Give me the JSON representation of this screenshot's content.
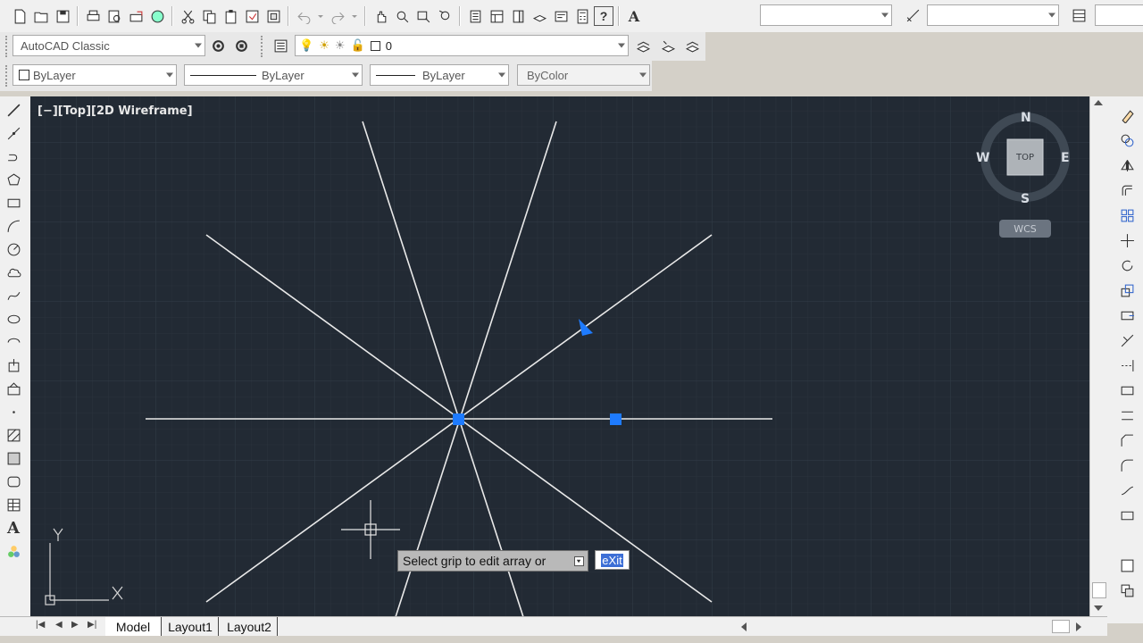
{
  "toolbars": {
    "workspace": {
      "value": "AutoCAD Classic"
    },
    "layer": {
      "value": "0"
    },
    "color": {
      "value": "ByLayer"
    },
    "linetype": {
      "value": "ByLayer"
    },
    "lineweight": {
      "value": "ByLayer"
    },
    "plotstyle": {
      "value": "ByColor"
    },
    "textstyle": {
      "value": ""
    },
    "dimstyle": {
      "value": ""
    }
  },
  "viewport": {
    "label": "[−][Top][2D Wireframe]",
    "navcube": {
      "top": "TOP",
      "north": "N",
      "south": "S",
      "east": "E",
      "west": "W",
      "ucs": "WCS"
    },
    "ucs_icon": {
      "x": "X",
      "y": "Y"
    }
  },
  "command": {
    "prompt": "Select grip to edit array or",
    "option": "eXit"
  },
  "layout_tabs": [
    {
      "label": "Model",
      "active": true
    },
    {
      "label": "Layout1",
      "active": false
    },
    {
      "label": "Layout2",
      "active": false
    }
  ],
  "colors": {
    "drawing_bg": "#222a34",
    "grip": "#1e7bff",
    "ui_bg": "#f0f0f0"
  }
}
